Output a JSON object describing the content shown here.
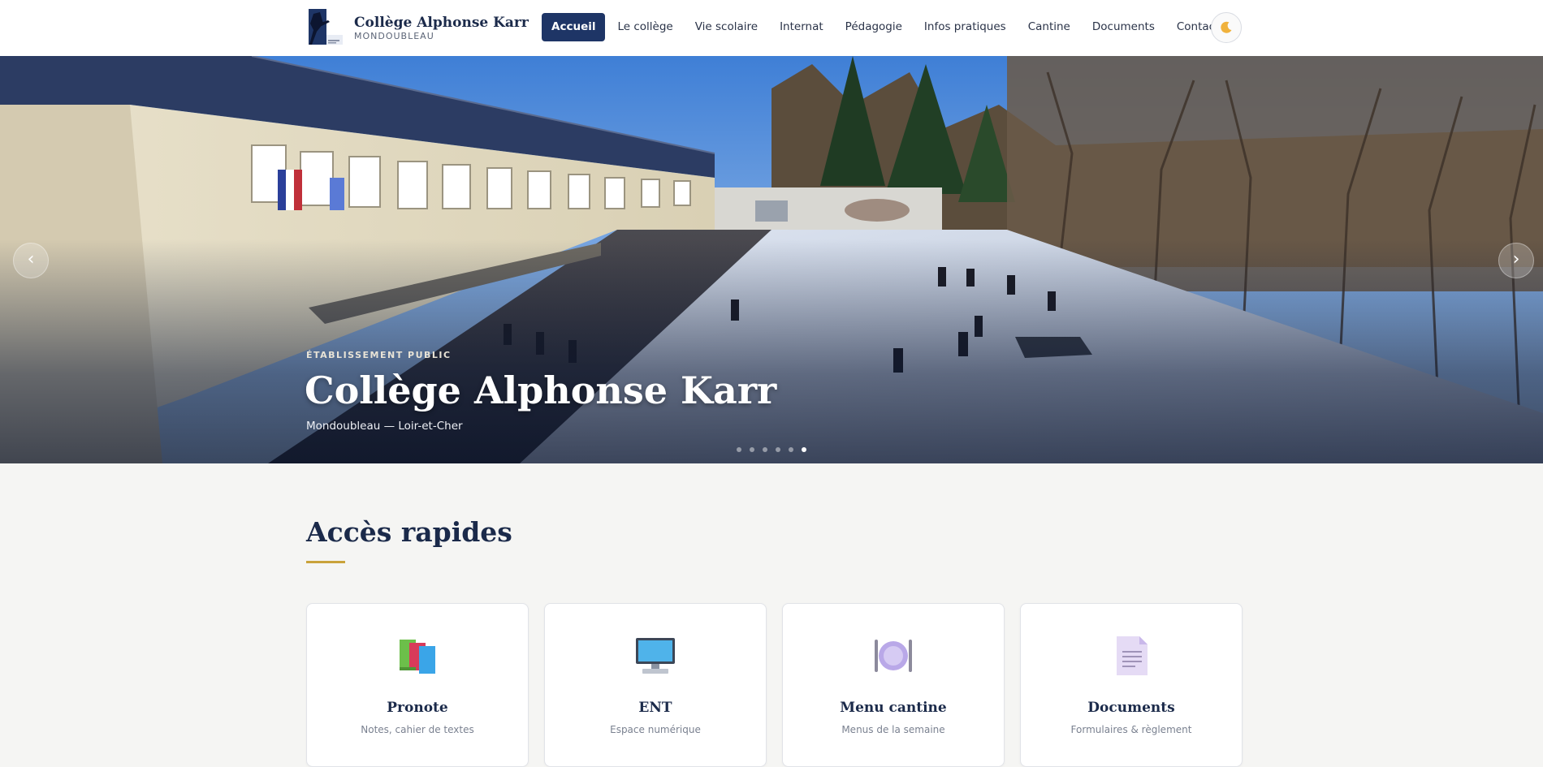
{
  "header": {
    "brand_name": "Collège Alphonse Karr",
    "brand_sub": "MONDOUBLEAU",
    "logo_icon": "college-logo",
    "theme_toggle_icon": "moon-icon",
    "nav": [
      {
        "label": "Accueil",
        "active": true
      },
      {
        "label": "Le collège",
        "active": false
      },
      {
        "label": "Vie scolaire",
        "active": false
      },
      {
        "label": "Internat",
        "active": false
      },
      {
        "label": "Pédagogie",
        "active": false
      },
      {
        "label": "Infos pratiques",
        "active": false
      },
      {
        "label": "Cantine",
        "active": false
      },
      {
        "label": "Documents",
        "active": false
      },
      {
        "label": "Contact",
        "active": false
      }
    ]
  },
  "hero": {
    "eyebrow": "ÉTABLISSEMENT PUBLIC",
    "title": "Collège Alphonse Karr",
    "subtitle": "Mondoubleau — Loir-et-Cher",
    "prev_label": "‹",
    "next_label": "›",
    "slide_count": 6,
    "active_slide": 6
  },
  "quick_access": {
    "title": "Accès rapides",
    "accent_color": "#c9a23a",
    "cards": [
      {
        "title": "Pronote",
        "icon": "books-icon",
        "desc": "Notes, cahier de textes"
      },
      {
        "title": "ENT",
        "icon": "computer-icon",
        "desc": "Espace numérique"
      },
      {
        "title": "Menu cantine",
        "icon": "plate-cutlery-icon",
        "desc": "Menus de la semaine"
      },
      {
        "title": "Documents",
        "icon": "document-icon",
        "desc": "Formulaires & règlement"
      }
    ]
  },
  "colors": {
    "primary": "#1e3566",
    "background": "#f5f5f3",
    "text": "#1b2a4a"
  }
}
